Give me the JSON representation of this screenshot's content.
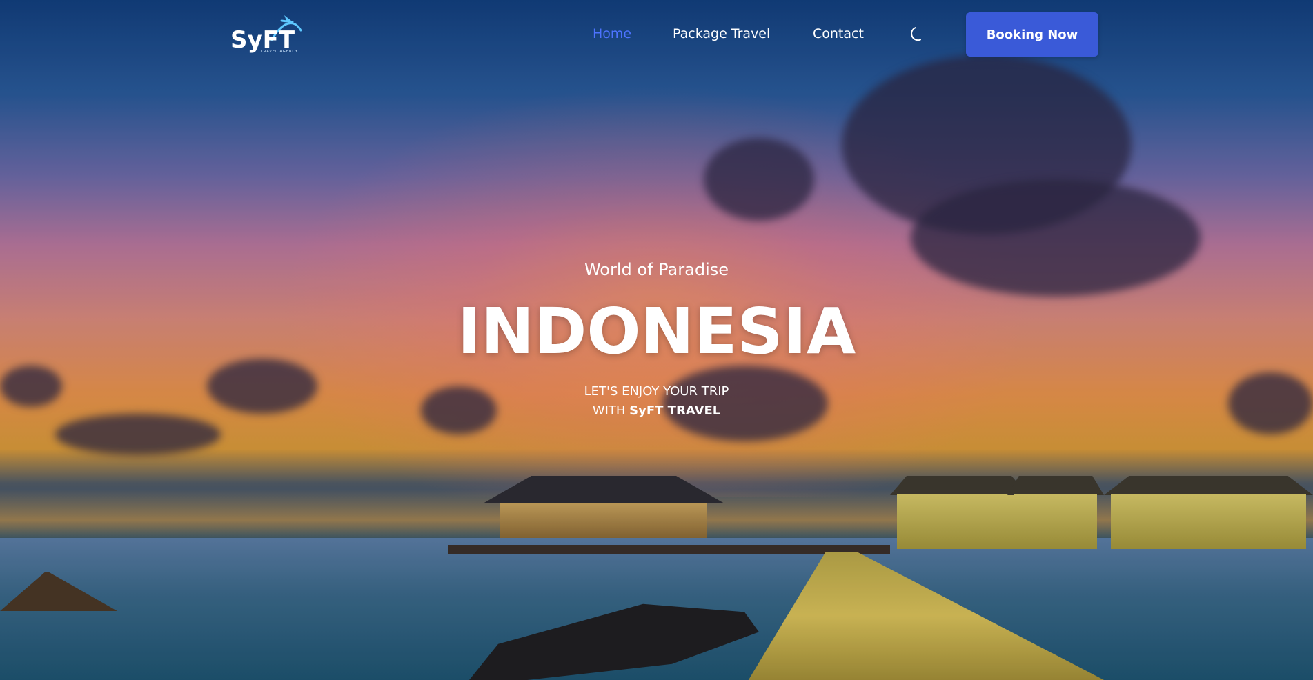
{
  "brand": {
    "name": "SyFT",
    "subtitle": "TRAVEL AGENCY"
  },
  "nav": {
    "items": [
      {
        "label": "Home",
        "active": true
      },
      {
        "label": "Package Travel",
        "active": false
      },
      {
        "label": "Contact",
        "active": false
      }
    ],
    "theme_toggle_icon": "moon-icon",
    "cta_label": "Booking Now"
  },
  "hero": {
    "subtitle": "World of Paradise",
    "title": "INDONESIA",
    "tagline_line1": "LET'S ENJOY YOUR TRIP",
    "tagline_prefix": "WITH ",
    "tagline_brand": "SyFT TRAVEL"
  },
  "colors": {
    "accent": "#3a5ad8",
    "active_link": "#4d73ff",
    "text": "#ffffff"
  }
}
